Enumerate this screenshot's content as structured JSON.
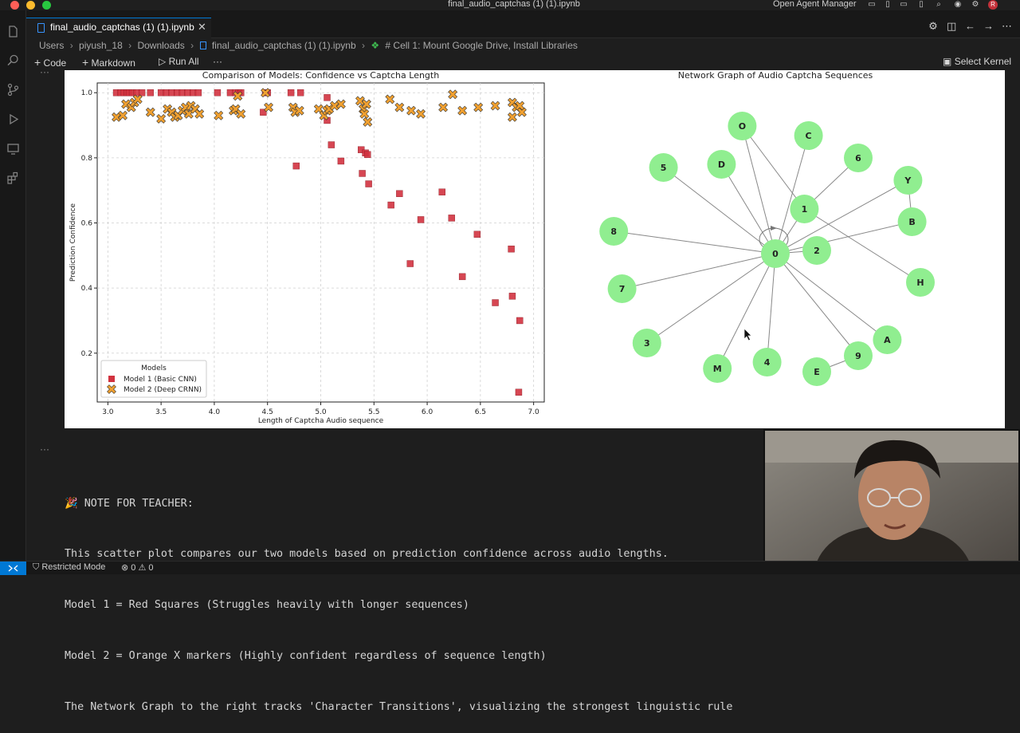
{
  "window": {
    "title": "final_audio_captchas (1) (1).ipynb",
    "right_label": "Open Agent Manager"
  },
  "tab": {
    "label": "final_audio_captchas (1) (1).ipynb",
    "close": "✕"
  },
  "breadcrumbs": {
    "users": "Users",
    "user": "piyush_18",
    "downloads": "Downloads",
    "file": "final_audio_captchas (1) (1).ipynb",
    "cell": "# Cell 1: Mount Google Drive, Install Libraries",
    "sep": "›"
  },
  "toolbar": {
    "code": "Code",
    "markdown": "Markdown",
    "run_all": "Run All",
    "more": "···",
    "select_kernel": "Select Kernel"
  },
  "cell_ellipsis": "···",
  "note_lines": [
    "🎉 NOTE FOR TEACHER:",
    "This scatter plot compares our two models based on prediction confidence across audio lengths.",
    "Model 1 = Red Squares (Struggles heavily with longer sequences)",
    "Model 2 = Orange X markers (Highly confident regardless of sequence length)",
    "The Network Graph to the right tracks 'Character Transitions', visualizing the strongest linguistic rule"
  ],
  "status": {
    "mode": "Restricted Mode",
    "errors": "0",
    "warnings": "0"
  },
  "colors": {
    "accent": "#0078d4",
    "model1": "#d1323f",
    "model2": "#f0a030",
    "node": "#90ee90"
  },
  "chart_data": [
    {
      "type": "scatter",
      "title": "Comparison of Models: Confidence vs Captcha Length",
      "xlabel": "Length of Captcha Audio sequence",
      "ylabel": "Prediction Confidence",
      "xlim": [
        2.9,
        7.1
      ],
      "ylim": [
        0.05,
        1.03
      ],
      "xticks": [
        "3.0",
        "3.5",
        "4.0",
        "4.5",
        "5.0",
        "5.5",
        "6.0",
        "6.5",
        "7.0"
      ],
      "yticks": [
        "0.2",
        "0.4",
        "0.6",
        "0.8",
        "1.0"
      ],
      "grid": true,
      "legend_title": "Models",
      "legend_position": "lower-left",
      "series": [
        {
          "name": "Model 1 (Basic CNN)",
          "marker": "square",
          "color": "#d1323f",
          "points": [
            [
              3.08,
              1.0
            ],
            [
              3.12,
              1.0
            ],
            [
              3.15,
              1.0
            ],
            [
              3.18,
              1.0
            ],
            [
              3.2,
              1.0
            ],
            [
              3.23,
              1.0
            ],
            [
              3.27,
              1.0
            ],
            [
              3.32,
              1.0
            ],
            [
              3.4,
              1.0
            ],
            [
              3.5,
              1.0
            ],
            [
              3.55,
              1.0
            ],
            [
              3.6,
              1.0
            ],
            [
              3.65,
              1.0
            ],
            [
              3.7,
              1.0
            ],
            [
              3.75,
              1.0
            ],
            [
              3.8,
              1.0
            ],
            [
              3.85,
              1.0
            ],
            [
              4.03,
              1.0
            ],
            [
              4.15,
              1.0
            ],
            [
              4.2,
              1.0
            ],
            [
              4.23,
              1.0
            ],
            [
              4.25,
              1.0
            ],
            [
              4.48,
              1.0
            ],
            [
              4.5,
              1.0
            ],
            [
              4.72,
              1.0
            ],
            [
              4.81,
              1.0
            ],
            [
              4.46,
              0.94
            ],
            [
              4.77,
              0.775
            ],
            [
              5.06,
              0.915
            ],
            [
              5.06,
              0.985
            ],
            [
              5.1,
              0.84
            ],
            [
              5.19,
              0.79
            ],
            [
              5.38,
              0.825
            ],
            [
              5.42,
              0.815
            ],
            [
              5.44,
              0.81
            ],
            [
              5.39,
              0.752
            ],
            [
              5.45,
              0.72
            ],
            [
              5.66,
              0.655
            ],
            [
              5.74,
              0.69
            ],
            [
              5.84,
              0.475
            ],
            [
              5.94,
              0.61
            ],
            [
              6.14,
              0.695
            ],
            [
              6.23,
              0.615
            ],
            [
              6.33,
              0.435
            ],
            [
              6.47,
              0.565
            ],
            [
              6.64,
              0.355
            ],
            [
              6.79,
              0.52
            ],
            [
              6.8,
              0.375
            ],
            [
              6.87,
              0.3
            ],
            [
              6.86,
              0.08
            ]
          ]
        },
        {
          "name": "Model 2 (Deep CRNN)",
          "marker": "x",
          "color": "#f0a030",
          "points": [
            [
              3.08,
              0.925
            ],
            [
              3.14,
              0.93
            ],
            [
              3.17,
              0.965
            ],
            [
              3.22,
              0.955
            ],
            [
              3.25,
              0.97
            ],
            [
              3.28,
              0.98
            ],
            [
              3.4,
              0.94
            ],
            [
              3.5,
              0.92
            ],
            [
              3.56,
              0.95
            ],
            [
              3.6,
              0.94
            ],
            [
              3.63,
              0.925
            ],
            [
              3.66,
              0.93
            ],
            [
              3.7,
              0.945
            ],
            [
              3.73,
              0.955
            ],
            [
              3.76,
              0.935
            ],
            [
              3.78,
              0.96
            ],
            [
              3.82,
              0.95
            ],
            [
              3.86,
              0.935
            ],
            [
              4.04,
              0.93
            ],
            [
              4.18,
              0.945
            ],
            [
              4.2,
              0.95
            ],
            [
              4.22,
              0.99
            ],
            [
              4.25,
              0.935
            ],
            [
              4.48,
              1.0
            ],
            [
              4.51,
              0.955
            ],
            [
              4.74,
              0.955
            ],
            [
              4.76,
              0.94
            ],
            [
              4.8,
              0.945
            ],
            [
              4.98,
              0.95
            ],
            [
              5.03,
              0.93
            ],
            [
              5.06,
              0.945
            ],
            [
              5.08,
              0.95
            ],
            [
              5.13,
              0.96
            ],
            [
              5.19,
              0.965
            ],
            [
              5.37,
              0.975
            ],
            [
              5.4,
              0.95
            ],
            [
              5.43,
              0.965
            ],
            [
              5.41,
              0.935
            ],
            [
              5.44,
              0.91
            ],
            [
              5.65,
              0.98
            ],
            [
              5.74,
              0.955
            ],
            [
              5.85,
              0.945
            ],
            [
              5.94,
              0.935
            ],
            [
              6.15,
              0.955
            ],
            [
              6.24,
              0.995
            ],
            [
              6.33,
              0.945
            ],
            [
              6.48,
              0.955
            ],
            [
              6.64,
              0.96
            ],
            [
              6.8,
              0.97
            ],
            [
              6.8,
              0.925
            ],
            [
              6.84,
              0.955
            ],
            [
              6.87,
              0.96
            ],
            [
              6.89,
              0.94
            ]
          ]
        }
      ]
    },
    {
      "type": "network",
      "title": "Network Graph of Audio Captcha Sequences",
      "nodes": [
        {
          "id": "0",
          "x": 0.5,
          "y": 0.5
        },
        {
          "id": "1",
          "x": 0.57,
          "y": 0.36
        },
        {
          "id": "2",
          "x": 0.6,
          "y": 0.49
        },
        {
          "id": "O",
          "x": 0.42,
          "y": 0.1
        },
        {
          "id": "C",
          "x": 0.58,
          "y": 0.13
        },
        {
          "id": "D",
          "x": 0.37,
          "y": 0.22
        },
        {
          "id": "6",
          "x": 0.7,
          "y": 0.2
        },
        {
          "id": "Y",
          "x": 0.82,
          "y": 0.27
        },
        {
          "id": "B",
          "x": 0.83,
          "y": 0.4
        },
        {
          "id": "5",
          "x": 0.23,
          "y": 0.23
        },
        {
          "id": "8",
          "x": 0.11,
          "y": 0.43
        },
        {
          "id": "7",
          "x": 0.13,
          "y": 0.61
        },
        {
          "id": "3",
          "x": 0.19,
          "y": 0.78
        },
        {
          "id": "M",
          "x": 0.36,
          "y": 0.86
        },
        {
          "id": "4",
          "x": 0.48,
          "y": 0.84
        },
        {
          "id": "E",
          "x": 0.6,
          "y": 0.87
        },
        {
          "id": "9",
          "x": 0.7,
          "y": 0.82
        },
        {
          "id": "A",
          "x": 0.77,
          "y": 0.77
        },
        {
          "id": "H",
          "x": 0.85,
          "y": 0.59
        }
      ],
      "edges": [
        [
          "0",
          "1"
        ],
        [
          "0",
          "2"
        ],
        [
          "0",
          "O"
        ],
        [
          "0",
          "C"
        ],
        [
          "0",
          "D"
        ],
        [
          "0",
          "5"
        ],
        [
          "0",
          "8"
        ],
        [
          "0",
          "7"
        ],
        [
          "0",
          "3"
        ],
        [
          "0",
          "M"
        ],
        [
          "0",
          "4"
        ],
        [
          "0",
          "9"
        ],
        [
          "0",
          "A"
        ],
        [
          "0",
          "Y"
        ],
        [
          "0",
          "B"
        ],
        [
          "1",
          "6"
        ],
        [
          "1",
          "H"
        ],
        [
          "1",
          "O"
        ],
        [
          "Y",
          "B"
        ],
        [
          "E",
          "9"
        ]
      ],
      "self_loops": [
        "0"
      ]
    }
  ]
}
